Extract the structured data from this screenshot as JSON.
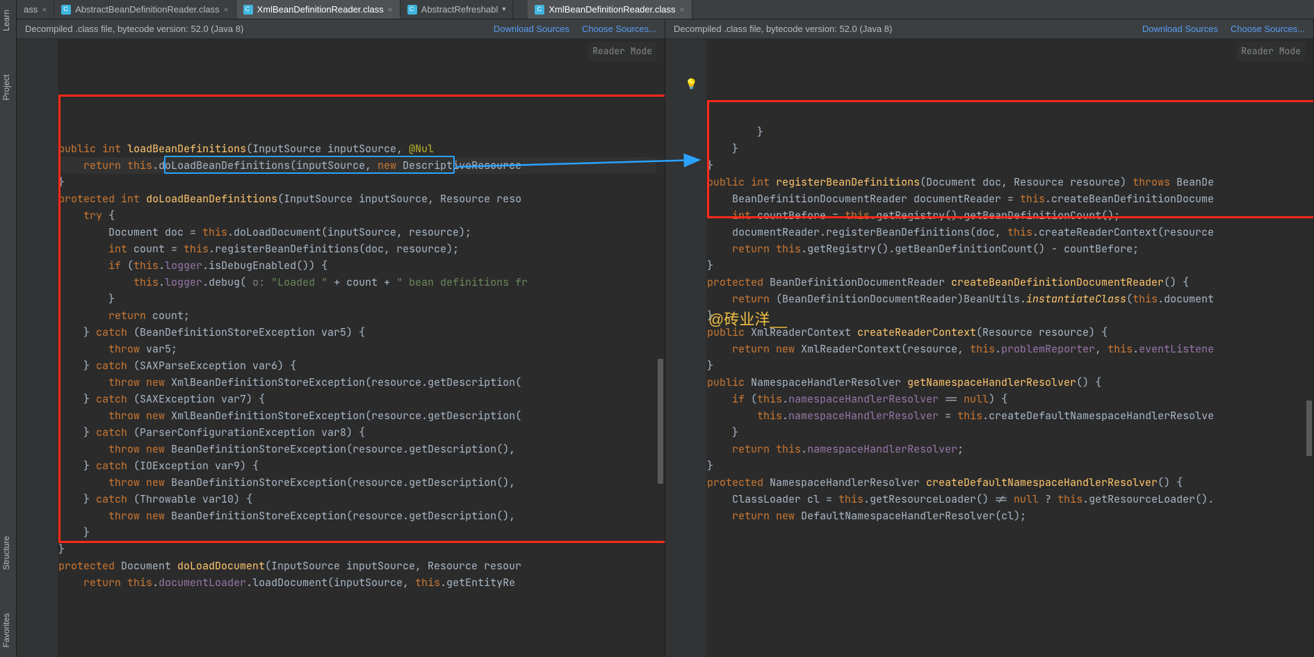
{
  "left_tools": {
    "top": [
      {
        "label": "Learn"
      },
      {
        "label": "Project"
      }
    ],
    "bottom": [
      {
        "label": "Structure"
      },
      {
        "label": "Favorites"
      }
    ]
  },
  "tabs": [
    {
      "label": "ass",
      "active": false,
      "closable": true,
      "icon": false
    },
    {
      "label": "AbstractBeanDefinitionReader.class",
      "active": false,
      "closable": true,
      "icon": true
    },
    {
      "label": "XmlBeanDefinitionReader.class",
      "active": true,
      "closable": true,
      "icon": true
    },
    {
      "label": "AbstractRefreshabl",
      "active": false,
      "closable": false,
      "chevron": true,
      "icon": true
    },
    {
      "label": "XmlBeanDefinitionReader.class",
      "active": true,
      "closable": true,
      "icon": true,
      "pane": "right"
    }
  ],
  "info_bar": {
    "text": "Decompiled .class file, bytecode version: 52.0 (Java 8)",
    "download": "Download Sources",
    "choose": "Choose Sources..."
  },
  "reader_mode": "Reader Mode",
  "watermark": "@砖业洋__",
  "left_code": [
    [
      [
        "kw",
        "public"
      ],
      [
        "",
        " "
      ],
      [
        "kw",
        "int"
      ],
      [
        "",
        " "
      ],
      [
        "method",
        "loadBeanDefinitions"
      ],
      [
        "",
        "(InputSource inputSource, "
      ],
      [
        "ann",
        "@Nul"
      ]
    ],
    [
      [
        "",
        "    "
      ],
      [
        "kw",
        "return"
      ],
      [
        "",
        " "
      ],
      [
        "kw",
        "this"
      ],
      [
        "",
        "."
      ],
      [
        "",
        "doLoadBeanDefinitions(inputSource, "
      ],
      [
        "kw",
        "new"
      ],
      [
        "",
        " DescriptiveResource"
      ]
    ],
    [
      [
        "",
        "}"
      ]
    ],
    [
      [
        "",
        ""
      ]
    ],
    [
      [
        "kw",
        "protected"
      ],
      [
        "",
        " "
      ],
      [
        "kw",
        "int"
      ],
      [
        "",
        " "
      ],
      [
        "method",
        "doLoadBeanDefinitions"
      ],
      [
        "",
        "(InputSource inputSource, Resource reso"
      ]
    ],
    [
      [
        "",
        "    "
      ],
      [
        "kw",
        "try"
      ],
      [
        "",
        " {"
      ]
    ],
    [
      [
        "",
        "        Document doc = "
      ],
      [
        "kw",
        "this"
      ],
      [
        "",
        ".doLoadDocument(inputSource, resource);"
      ]
    ],
    [
      [
        "",
        "        "
      ],
      [
        "kw",
        "int"
      ],
      [
        "",
        " count = "
      ],
      [
        "kw",
        "this"
      ],
      [
        "",
        ".registerBeanDefinitions(doc, resource);"
      ]
    ],
    [
      [
        "",
        "        "
      ],
      [
        "kw",
        "if"
      ],
      [
        "",
        " ("
      ],
      [
        "kw",
        "this"
      ],
      [
        "",
        "."
      ],
      [
        "field",
        "logger"
      ],
      [
        "",
        ".isDebugEnabled()) {"
      ]
    ],
    [
      [
        "",
        "            "
      ],
      [
        "kw",
        "this"
      ],
      [
        "",
        "."
      ],
      [
        "field",
        "logger"
      ],
      [
        "",
        ".debug("
      ],
      [
        "gray",
        " o: "
      ],
      [
        "str",
        "\"Loaded \""
      ],
      [
        "",
        " + count + "
      ],
      [
        "str",
        "\" bean definitions fr"
      ]
    ],
    [
      [
        "",
        "        }"
      ]
    ],
    [
      [
        "",
        ""
      ]
    ],
    [
      [
        "",
        "        "
      ],
      [
        "kw",
        "return"
      ],
      [
        "",
        " count;"
      ]
    ],
    [
      [
        "",
        "    } "
      ],
      [
        "kw",
        "catch"
      ],
      [
        "",
        " (BeanDefinitionStoreException var5) {"
      ]
    ],
    [
      [
        "",
        "        "
      ],
      [
        "kw",
        "throw"
      ],
      [
        "",
        " var5;"
      ]
    ],
    [
      [
        "",
        "    } "
      ],
      [
        "kw",
        "catch"
      ],
      [
        "",
        " (SAXParseException var6) {"
      ]
    ],
    [
      [
        "",
        "        "
      ],
      [
        "kw",
        "throw"
      ],
      [
        "",
        " "
      ],
      [
        "kw",
        "new"
      ],
      [
        "",
        " XmlBeanDefinitionStoreException(resource.getDescription("
      ]
    ],
    [
      [
        "",
        "    } "
      ],
      [
        "kw",
        "catch"
      ],
      [
        "",
        " (SAXException var7) {"
      ]
    ],
    [
      [
        "",
        "        "
      ],
      [
        "kw",
        "throw"
      ],
      [
        "",
        " "
      ],
      [
        "kw",
        "new"
      ],
      [
        "",
        " XmlBeanDefinitionStoreException(resource.getDescription("
      ]
    ],
    [
      [
        "",
        "    } "
      ],
      [
        "kw",
        "catch"
      ],
      [
        "",
        " (ParserConfigurationException var8) {"
      ]
    ],
    [
      [
        "",
        "        "
      ],
      [
        "kw",
        "throw"
      ],
      [
        "",
        " "
      ],
      [
        "kw",
        "new"
      ],
      [
        "",
        " BeanDefinitionStoreException(resource.getDescription(),"
      ]
    ],
    [
      [
        "",
        "    } "
      ],
      [
        "kw",
        "catch"
      ],
      [
        "",
        " (IOException var9) {"
      ]
    ],
    [
      [
        "",
        "        "
      ],
      [
        "kw",
        "throw"
      ],
      [
        "",
        " "
      ],
      [
        "kw",
        "new"
      ],
      [
        "",
        " BeanDefinitionStoreException(resource.getDescription(),"
      ]
    ],
    [
      [
        "",
        "    } "
      ],
      [
        "kw",
        "catch"
      ],
      [
        "",
        " (Throwable var10) {"
      ]
    ],
    [
      [
        "",
        "        "
      ],
      [
        "kw",
        "throw"
      ],
      [
        "",
        " "
      ],
      [
        "kw",
        "new"
      ],
      [
        "",
        " BeanDefinitionStoreException(resource.getDescription(),"
      ]
    ],
    [
      [
        "",
        "    }"
      ]
    ],
    [
      [
        "",
        "}"
      ]
    ],
    [
      [
        "",
        ""
      ]
    ],
    [
      [
        "kw",
        "protected"
      ],
      [
        "",
        " Document "
      ],
      [
        "method",
        "doLoadDocument"
      ],
      [
        "",
        "(InputSource inputSource, Resource resour"
      ]
    ],
    [
      [
        "",
        "    "
      ],
      [
        "kw",
        "return"
      ],
      [
        "",
        " "
      ],
      [
        "kw",
        "this"
      ],
      [
        "",
        "."
      ],
      [
        "field",
        "documentLoader"
      ],
      [
        "",
        ".loadDocument(inputSource, "
      ],
      [
        "kw",
        "this"
      ],
      [
        "",
        ".getEntityRe"
      ]
    ]
  ],
  "right_code": [
    [
      [
        "",
        "        }"
      ]
    ],
    [
      [
        "",
        "    }"
      ]
    ],
    [
      [
        "",
        "}"
      ]
    ],
    [
      [
        "",
        ""
      ]
    ],
    [
      [
        "kw",
        "public"
      ],
      [
        "",
        " "
      ],
      [
        "kw",
        "int"
      ],
      [
        "",
        " "
      ],
      [
        "method",
        "registerBeanDefinitions"
      ],
      [
        "",
        "(Document doc, Resource resource) "
      ],
      [
        "kw",
        "throws"
      ],
      [
        "",
        " BeanDe"
      ]
    ],
    [
      [
        "",
        "    BeanDefinitionDocumentReader documentReader = "
      ],
      [
        "kw",
        "this"
      ],
      [
        "",
        ".createBeanDefinitionDocume"
      ]
    ],
    [
      [
        "",
        "    "
      ],
      [
        "kw",
        "int"
      ],
      [
        "",
        " countBefore = "
      ],
      [
        "kw",
        "this"
      ],
      [
        "",
        ".getRegistry().getBeanDefinitionCount();"
      ]
    ],
    [
      [
        "",
        "    documentReader.registerBeanDefinitions(doc, "
      ],
      [
        "kw",
        "this"
      ],
      [
        "",
        ".createReaderContext(resource"
      ]
    ],
    [
      [
        "",
        "    "
      ],
      [
        "kw",
        "return"
      ],
      [
        "",
        " "
      ],
      [
        "kw",
        "this"
      ],
      [
        "",
        ".getRegistry().getBeanDefinitionCount() - countBefore;"
      ]
    ],
    [
      [
        "",
        "}"
      ]
    ],
    [
      [
        "",
        ""
      ]
    ],
    [
      [
        "kw",
        "protected"
      ],
      [
        "",
        " BeanDefinitionDocumentReader "
      ],
      [
        "method",
        "createBeanDefinitionDocumentReader"
      ],
      [
        "",
        "() {"
      ]
    ],
    [
      [
        "",
        "    "
      ],
      [
        "kw",
        "return"
      ],
      [
        "",
        " (BeanDefinitionDocumentReader)BeanUtils."
      ],
      [
        "meth-i",
        "instantiateClass"
      ],
      [
        "",
        "("
      ],
      [
        "kw",
        "this"
      ],
      [
        "",
        ".document"
      ]
    ],
    [
      [
        "",
        "}"
      ]
    ],
    [
      [
        "",
        ""
      ]
    ],
    [
      [
        "kw",
        "public"
      ],
      [
        "",
        " XmlReaderContext "
      ],
      [
        "method",
        "createReaderContext"
      ],
      [
        "",
        "(Resource resource) {"
      ]
    ],
    [
      [
        "",
        "    "
      ],
      [
        "kw",
        "return"
      ],
      [
        "",
        " "
      ],
      [
        "kw",
        "new"
      ],
      [
        "",
        " XmlReaderContext(resource, "
      ],
      [
        "kw",
        "this"
      ],
      [
        "",
        "."
      ],
      [
        "field",
        "problemReporter"
      ],
      [
        "",
        ", "
      ],
      [
        "kw",
        "this"
      ],
      [
        "",
        "."
      ],
      [
        "field",
        "eventListene"
      ]
    ],
    [
      [
        "",
        "}"
      ]
    ],
    [
      [
        "",
        ""
      ]
    ],
    [
      [
        "kw",
        "public"
      ],
      [
        "",
        " NamespaceHandlerResolver "
      ],
      [
        "method",
        "getNamespaceHandlerResolver"
      ],
      [
        "",
        "() {"
      ]
    ],
    [
      [
        "",
        "    "
      ],
      [
        "kw",
        "if"
      ],
      [
        "",
        " ("
      ],
      [
        "kw",
        "this"
      ],
      [
        "",
        "."
      ],
      [
        "field",
        "namespaceHandlerResolver"
      ],
      [
        "",
        " == "
      ],
      [
        "kw",
        "null"
      ],
      [
        "",
        ") {"
      ]
    ],
    [
      [
        "",
        "        "
      ],
      [
        "kw",
        "this"
      ],
      [
        "",
        "."
      ],
      [
        "field",
        "namespaceHandlerResolver"
      ],
      [
        "",
        " = "
      ],
      [
        "kw",
        "this"
      ],
      [
        "",
        ".createDefaultNamespaceHandlerResolve"
      ]
    ],
    [
      [
        "",
        "    }"
      ]
    ],
    [
      [
        "",
        ""
      ]
    ],
    [
      [
        "",
        "    "
      ],
      [
        "kw",
        "return"
      ],
      [
        "",
        " "
      ],
      [
        "kw",
        "this"
      ],
      [
        "",
        "."
      ],
      [
        "field",
        "namespaceHandlerResolver"
      ],
      [
        "",
        ";"
      ]
    ],
    [
      [
        "",
        "}"
      ]
    ],
    [
      [
        "",
        ""
      ]
    ],
    [
      [
        "kw",
        "protected"
      ],
      [
        "",
        " NamespaceHandlerResolver "
      ],
      [
        "method",
        "createDefaultNamespaceHandlerResolver"
      ],
      [
        "",
        "() {"
      ]
    ],
    [
      [
        "",
        "    ClassLoader cl = "
      ],
      [
        "kw",
        "this"
      ],
      [
        "",
        ".getResourceLoader() != "
      ],
      [
        "kw",
        "null"
      ],
      [
        "",
        " ? "
      ],
      [
        "kw",
        "this"
      ],
      [
        "",
        ".getResourceLoader()."
      ]
    ],
    [
      [
        "",
        "    "
      ],
      [
        "kw",
        "return"
      ],
      [
        "",
        " "
      ],
      [
        "kw",
        "new"
      ],
      [
        "",
        " DefaultNamespaceHandlerResolver(cl);"
      ]
    ]
  ]
}
